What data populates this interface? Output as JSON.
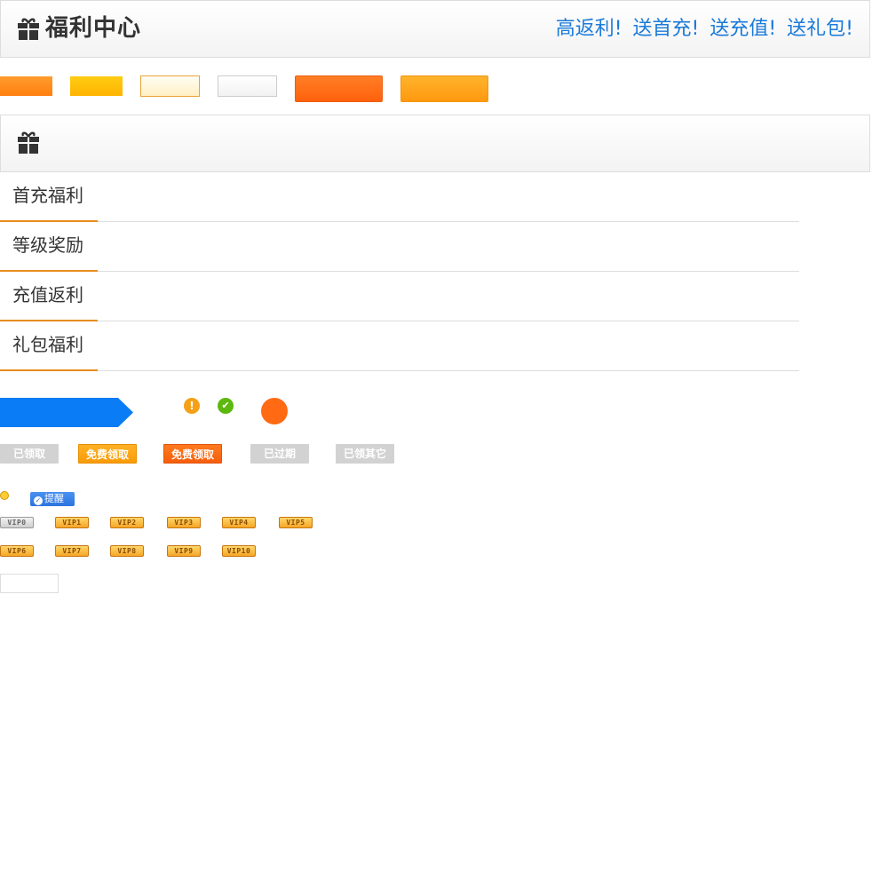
{
  "header": {
    "title": "福利中心",
    "icon": "gift-icon",
    "slogans": [
      "高返利!",
      "送首充!",
      "送充值!",
      "送礼包!"
    ],
    "slogan_color": "#1a7ad9"
  },
  "swatches": [
    "#ff8c1a",
    "#ffc107",
    "#fff3cc",
    "#f7f7f7",
    "#ff6a13",
    "#ffa31a"
  ],
  "panel": {
    "icon": "gift-icon"
  },
  "nav": {
    "items": [
      "首充福利",
      "等级奖励",
      "充值返利",
      "礼包福利"
    ],
    "accent_color": "#e88c1e"
  },
  "status": {
    "arrow_color": "#0a7cf5",
    "warning_color": "#f4a118",
    "success_color": "#5cb80f",
    "dot_color": "#ff6a13"
  },
  "claim_buttons": {
    "received": "已领取",
    "free_claim": "免费领取",
    "free_claim_active": "免费领取",
    "expired": "已过期",
    "claimed_other": "已领其它"
  },
  "remind": {
    "label": "提醒"
  },
  "vip_badges": {
    "row1": [
      "VIP0",
      "VIP1",
      "VIP2",
      "VIP3",
      "VIP4",
      "VIP5"
    ],
    "row2": [
      "VIP6",
      "VIP7",
      "VIP8",
      "VIP9",
      "VIP10"
    ]
  }
}
